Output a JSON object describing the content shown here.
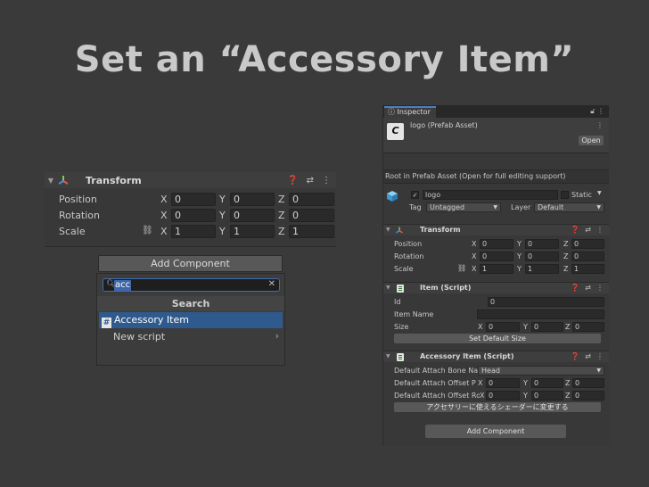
{
  "slide_title": "Set an “Accessory Item”",
  "left_transform": {
    "title": "Transform",
    "rows": [
      {
        "label": "Position",
        "x": "0",
        "y": "0",
        "z": "0"
      },
      {
        "label": "Rotation",
        "x": "0",
        "y": "0",
        "z": "0"
      },
      {
        "label": "Scale",
        "x": "1",
        "y": "1",
        "z": "1"
      }
    ],
    "axes": {
      "x": "X",
      "y": "Y",
      "z": "Z"
    }
  },
  "add_component": {
    "button_label": "Add Component",
    "search_value": "acc",
    "header": "Search",
    "items": [
      "Accessory Item",
      "New script"
    ]
  },
  "inspector": {
    "tab_label": "Inspector",
    "asset_name": "logo (Prefab Asset)",
    "logo_glyph": "C",
    "open_label": "Open",
    "root_info": "Root in Prefab Asset (Open for full editing support)",
    "object_name": "logo",
    "static_label": "Static",
    "tag_label": "Tag",
    "tag_value": "Untagged",
    "layer_label": "Layer",
    "layer_value": "Default",
    "transform": {
      "title": "Transform",
      "rows": [
        {
          "label": "Position",
          "x": "0",
          "y": "0",
          "z": "0"
        },
        {
          "label": "Rotation",
          "x": "0",
          "y": "0",
          "z": "0"
        },
        {
          "label": "Scale",
          "x": "1",
          "y": "1",
          "z": "1"
        }
      ]
    },
    "item_script": {
      "title": "Item (Script)",
      "id_label": "Id",
      "id_value": "0",
      "name_label": "Item Name",
      "name_value": "",
      "size_label": "Size",
      "size_x": "0",
      "size_y": "0",
      "size_z": "0",
      "button": "Set Default Size"
    },
    "accessory_script": {
      "title": "Accessory Item (Script)",
      "bone_label": "Default Attach Bone Na",
      "bone_value": "Head",
      "pos_label": "Default Attach Offset P",
      "pos_x": "0",
      "pos_y": "0",
      "pos_z": "0",
      "rot_label": "Default Attach Offset Ro",
      "rot_x": "0",
      "rot_y": "0",
      "rot_z": "0",
      "button": "アクセサリーに使えるシェーダーに変更する"
    },
    "add_component_label": "Add Component"
  },
  "colors": {
    "accent": "#4a7fc4",
    "selection": "#2f5a8e",
    "background": "#3a3a3a"
  }
}
